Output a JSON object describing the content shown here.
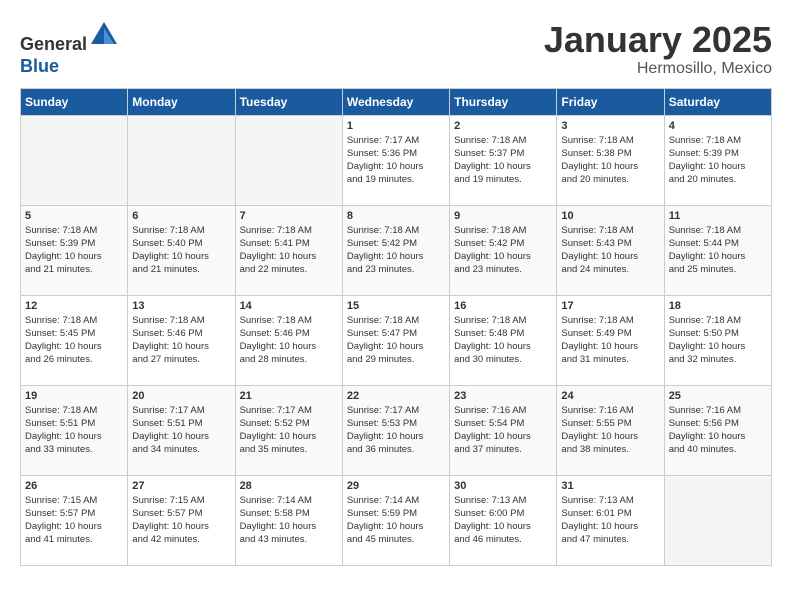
{
  "header": {
    "logo_line1": "General",
    "logo_line2": "Blue",
    "month_year": "January 2025",
    "location": "Hermosillo, Mexico"
  },
  "days_of_week": [
    "Sunday",
    "Monday",
    "Tuesday",
    "Wednesday",
    "Thursday",
    "Friday",
    "Saturday"
  ],
  "weeks": [
    [
      {
        "day": "",
        "info": ""
      },
      {
        "day": "",
        "info": ""
      },
      {
        "day": "",
        "info": ""
      },
      {
        "day": "1",
        "info": "Sunrise: 7:17 AM\nSunset: 5:36 PM\nDaylight: 10 hours\nand 19 minutes."
      },
      {
        "day": "2",
        "info": "Sunrise: 7:18 AM\nSunset: 5:37 PM\nDaylight: 10 hours\nand 19 minutes."
      },
      {
        "day": "3",
        "info": "Sunrise: 7:18 AM\nSunset: 5:38 PM\nDaylight: 10 hours\nand 20 minutes."
      },
      {
        "day": "4",
        "info": "Sunrise: 7:18 AM\nSunset: 5:39 PM\nDaylight: 10 hours\nand 20 minutes."
      }
    ],
    [
      {
        "day": "5",
        "info": "Sunrise: 7:18 AM\nSunset: 5:39 PM\nDaylight: 10 hours\nand 21 minutes."
      },
      {
        "day": "6",
        "info": "Sunrise: 7:18 AM\nSunset: 5:40 PM\nDaylight: 10 hours\nand 21 minutes."
      },
      {
        "day": "7",
        "info": "Sunrise: 7:18 AM\nSunset: 5:41 PM\nDaylight: 10 hours\nand 22 minutes."
      },
      {
        "day": "8",
        "info": "Sunrise: 7:18 AM\nSunset: 5:42 PM\nDaylight: 10 hours\nand 23 minutes."
      },
      {
        "day": "9",
        "info": "Sunrise: 7:18 AM\nSunset: 5:42 PM\nDaylight: 10 hours\nand 23 minutes."
      },
      {
        "day": "10",
        "info": "Sunrise: 7:18 AM\nSunset: 5:43 PM\nDaylight: 10 hours\nand 24 minutes."
      },
      {
        "day": "11",
        "info": "Sunrise: 7:18 AM\nSunset: 5:44 PM\nDaylight: 10 hours\nand 25 minutes."
      }
    ],
    [
      {
        "day": "12",
        "info": "Sunrise: 7:18 AM\nSunset: 5:45 PM\nDaylight: 10 hours\nand 26 minutes."
      },
      {
        "day": "13",
        "info": "Sunrise: 7:18 AM\nSunset: 5:46 PM\nDaylight: 10 hours\nand 27 minutes."
      },
      {
        "day": "14",
        "info": "Sunrise: 7:18 AM\nSunset: 5:46 PM\nDaylight: 10 hours\nand 28 minutes."
      },
      {
        "day": "15",
        "info": "Sunrise: 7:18 AM\nSunset: 5:47 PM\nDaylight: 10 hours\nand 29 minutes."
      },
      {
        "day": "16",
        "info": "Sunrise: 7:18 AM\nSunset: 5:48 PM\nDaylight: 10 hours\nand 30 minutes."
      },
      {
        "day": "17",
        "info": "Sunrise: 7:18 AM\nSunset: 5:49 PM\nDaylight: 10 hours\nand 31 minutes."
      },
      {
        "day": "18",
        "info": "Sunrise: 7:18 AM\nSunset: 5:50 PM\nDaylight: 10 hours\nand 32 minutes."
      }
    ],
    [
      {
        "day": "19",
        "info": "Sunrise: 7:18 AM\nSunset: 5:51 PM\nDaylight: 10 hours\nand 33 minutes."
      },
      {
        "day": "20",
        "info": "Sunrise: 7:17 AM\nSunset: 5:51 PM\nDaylight: 10 hours\nand 34 minutes."
      },
      {
        "day": "21",
        "info": "Sunrise: 7:17 AM\nSunset: 5:52 PM\nDaylight: 10 hours\nand 35 minutes."
      },
      {
        "day": "22",
        "info": "Sunrise: 7:17 AM\nSunset: 5:53 PM\nDaylight: 10 hours\nand 36 minutes."
      },
      {
        "day": "23",
        "info": "Sunrise: 7:16 AM\nSunset: 5:54 PM\nDaylight: 10 hours\nand 37 minutes."
      },
      {
        "day": "24",
        "info": "Sunrise: 7:16 AM\nSunset: 5:55 PM\nDaylight: 10 hours\nand 38 minutes."
      },
      {
        "day": "25",
        "info": "Sunrise: 7:16 AM\nSunset: 5:56 PM\nDaylight: 10 hours\nand 40 minutes."
      }
    ],
    [
      {
        "day": "26",
        "info": "Sunrise: 7:15 AM\nSunset: 5:57 PM\nDaylight: 10 hours\nand 41 minutes."
      },
      {
        "day": "27",
        "info": "Sunrise: 7:15 AM\nSunset: 5:57 PM\nDaylight: 10 hours\nand 42 minutes."
      },
      {
        "day": "28",
        "info": "Sunrise: 7:14 AM\nSunset: 5:58 PM\nDaylight: 10 hours\nand 43 minutes."
      },
      {
        "day": "29",
        "info": "Sunrise: 7:14 AM\nSunset: 5:59 PM\nDaylight: 10 hours\nand 45 minutes."
      },
      {
        "day": "30",
        "info": "Sunrise: 7:13 AM\nSunset: 6:00 PM\nDaylight: 10 hours\nand 46 minutes."
      },
      {
        "day": "31",
        "info": "Sunrise: 7:13 AM\nSunset: 6:01 PM\nDaylight: 10 hours\nand 47 minutes."
      },
      {
        "day": "",
        "info": ""
      }
    ]
  ]
}
